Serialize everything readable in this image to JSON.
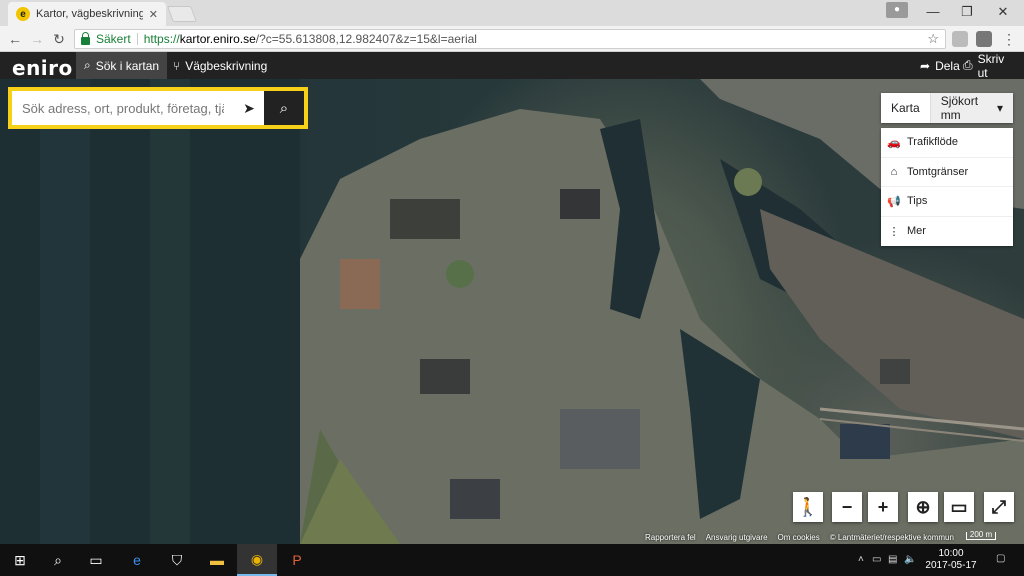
{
  "browser": {
    "tab_title": "Kartor, vägbeskrivningar,",
    "favicon_letter": "e",
    "security_label": "Säkert",
    "url_scheme": "https://",
    "url_host": "kartor.eniro.se",
    "url_path": "/?c=55.613808,12.982407&z=15&l=aerial",
    "window_controls": [
      "minimize",
      "restore",
      "close"
    ]
  },
  "header": {
    "logo": "eniro",
    "nav": [
      {
        "label": "Sök i kartan",
        "icon": "search-icon",
        "active": true
      },
      {
        "label": "Vägbeskrivning",
        "icon": "route-icon",
        "active": false
      }
    ],
    "share_label": "Dela",
    "print_label": "Skriv ut"
  },
  "search": {
    "placeholder": "Sök adress, ort, produkt, företag, tjänst",
    "accent": "#f7d117"
  },
  "map_type": {
    "options": [
      "Karta",
      "Sjökort mm"
    ],
    "selected": "Sjökort mm"
  },
  "layers": [
    {
      "label": "Trafikflöde",
      "icon": "car-icon"
    },
    {
      "label": "Tomtgränser",
      "icon": "property-icon"
    },
    {
      "label": "Tips",
      "icon": "megaphone-icon"
    },
    {
      "label": "Mer",
      "icon": "more-icon"
    }
  ],
  "map_controls": [
    "pegman",
    "zoom-out",
    "zoom-in",
    "my-location",
    "measure",
    "fullscreen"
  ],
  "attribution": [
    "Rapportera fel",
    "Ansvarig utgivare",
    "Om cookies",
    "© Lantmäteriet/respektive kommun"
  ],
  "scale_label": "200 m",
  "taskbar": {
    "time": "10:00",
    "date": "2017-05-17"
  }
}
